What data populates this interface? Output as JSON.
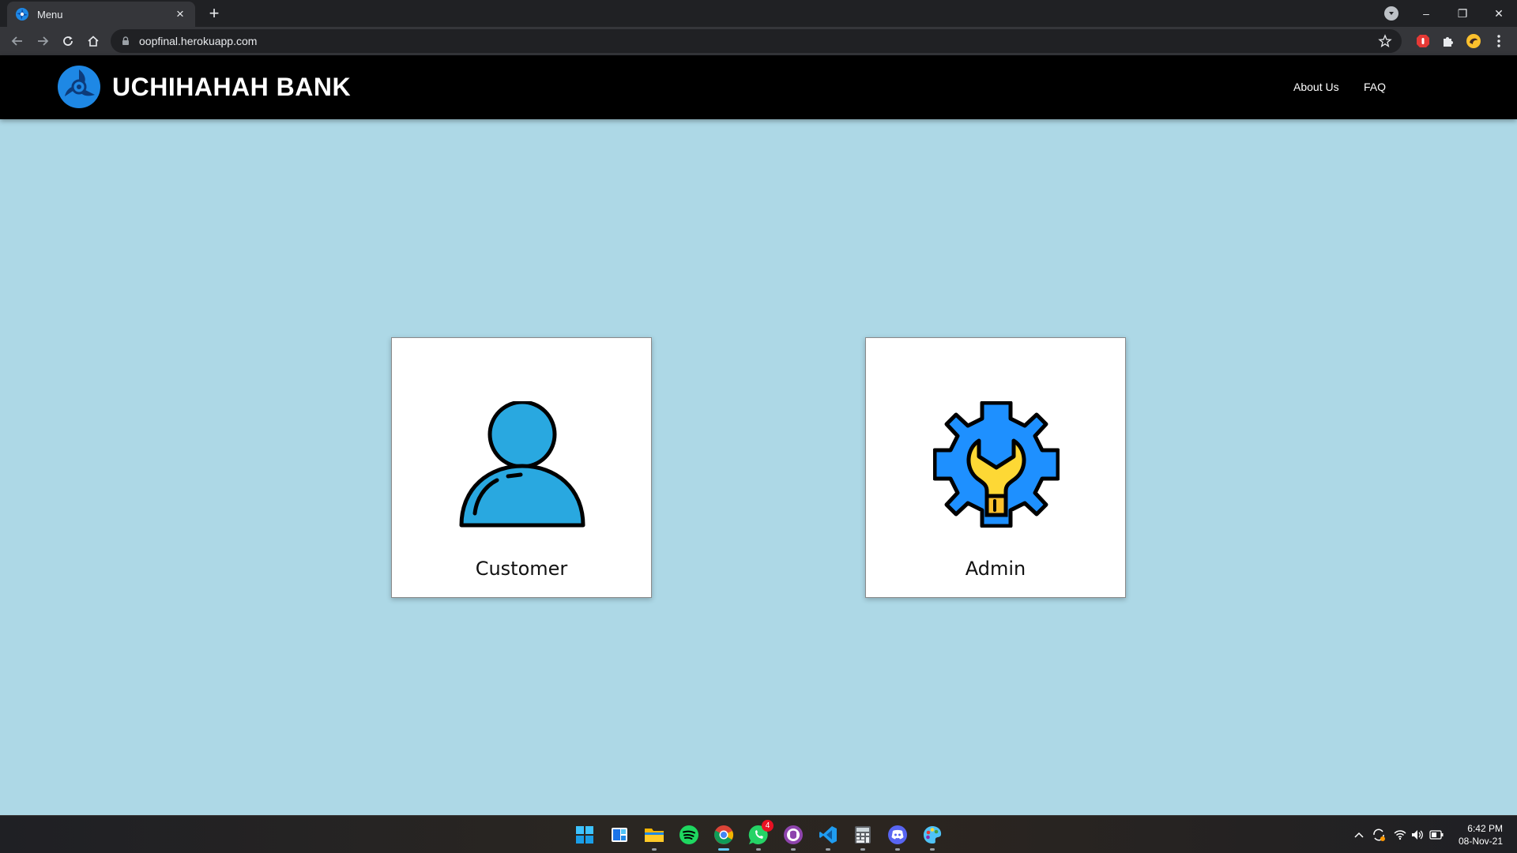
{
  "browser": {
    "tab_title": "Menu",
    "tab_close": "×",
    "new_tab": "+",
    "url": "oopfinal.herokuapp.com",
    "window_controls": {
      "minimize": "–",
      "restore": "❐",
      "close": "✕"
    }
  },
  "site": {
    "brand_name": "UCHIHAHAH BANK",
    "nav": {
      "about": "About Us",
      "faq": "FAQ"
    },
    "accent_color": "#1e88e5"
  },
  "cards": {
    "customer": {
      "label": "Customer",
      "icon": "user-icon"
    },
    "admin": {
      "label": "Admin",
      "icon": "gear-wrench-icon"
    }
  },
  "taskbar": {
    "whatsapp_badge": "4",
    "time": "6:42 PM",
    "date": "08-Nov-21"
  }
}
